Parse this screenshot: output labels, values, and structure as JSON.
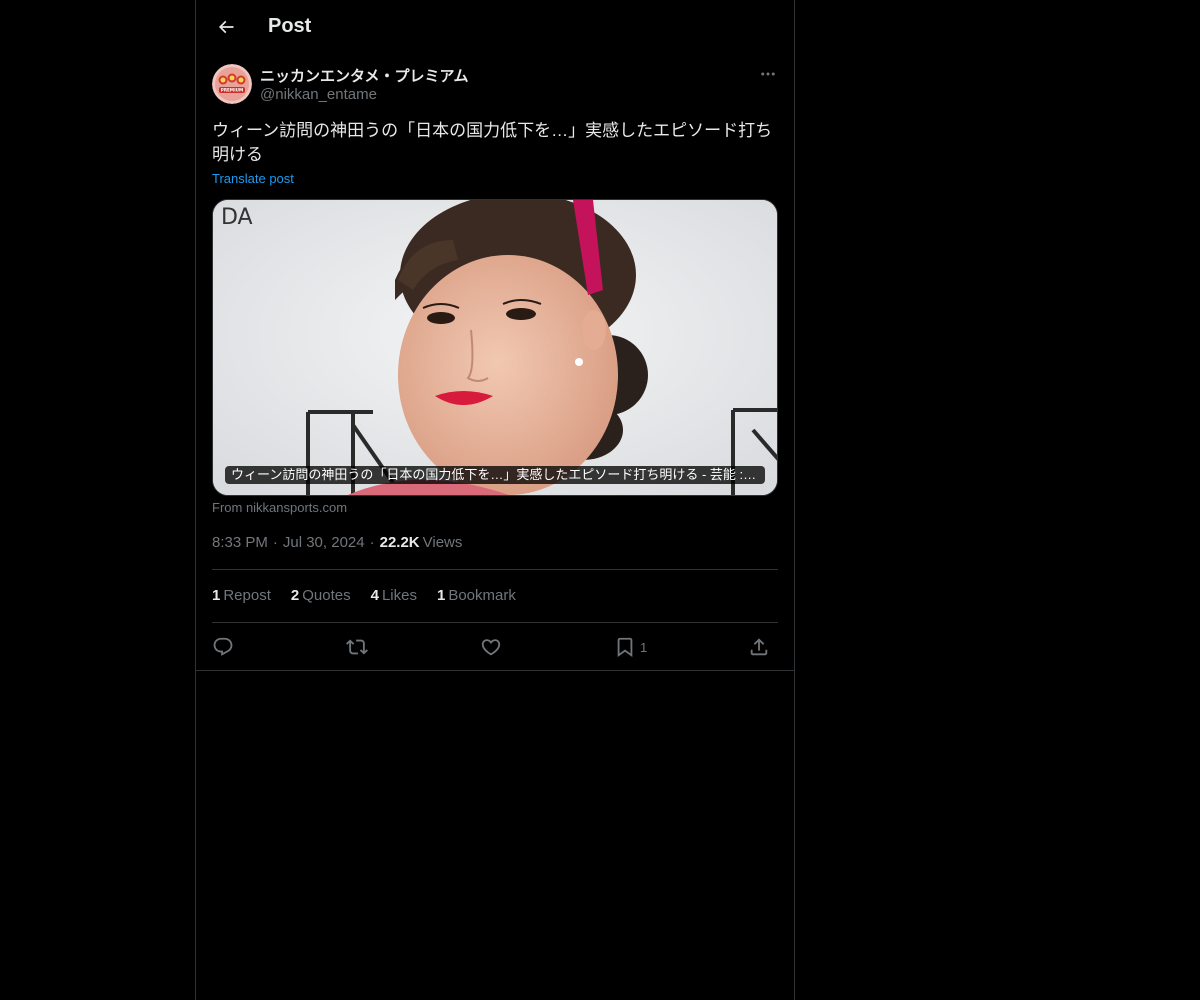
{
  "header": {
    "title": "Post"
  },
  "author": {
    "display_name": "ニッカンエンタメ・プレミアム",
    "handle": "@nikkan_entame",
    "avatar_text": "PREMIUM"
  },
  "post": {
    "text": "ウィーン訪問の神田うの「日本の国力低下を…」実感したエピソード打ち明ける",
    "translate_label": "Translate post"
  },
  "card": {
    "caption": "ウィーン訪問の神田うの「日本の国力低下を…」実感したエピソード打ち明ける - 芸能 : 日刊スポーツ",
    "source": "From nikkansports.com",
    "background_text": "DA"
  },
  "meta": {
    "time": "8:33 PM",
    "date": "Jul 30, 2024",
    "views_count": "22.2K",
    "views_label": "Views"
  },
  "stats": {
    "reposts_count": "1",
    "reposts_label": "Repost",
    "quotes_count": "2",
    "quotes_label": "Quotes",
    "likes_count": "4",
    "likes_label": "Likes",
    "bookmarks_count": "1",
    "bookmarks_label": "Bookmark"
  },
  "actions": {
    "bookmark_count": "1"
  },
  "colors": {
    "background": "#000000",
    "text": "#e7e9ea",
    "secondary": "#71767b",
    "link": "#1d9bf0",
    "border": "#2f3336"
  },
  "icons": [
    "back-arrow-icon",
    "more-icon",
    "reply-icon",
    "repost-icon",
    "like-icon",
    "bookmark-icon",
    "share-icon"
  ]
}
